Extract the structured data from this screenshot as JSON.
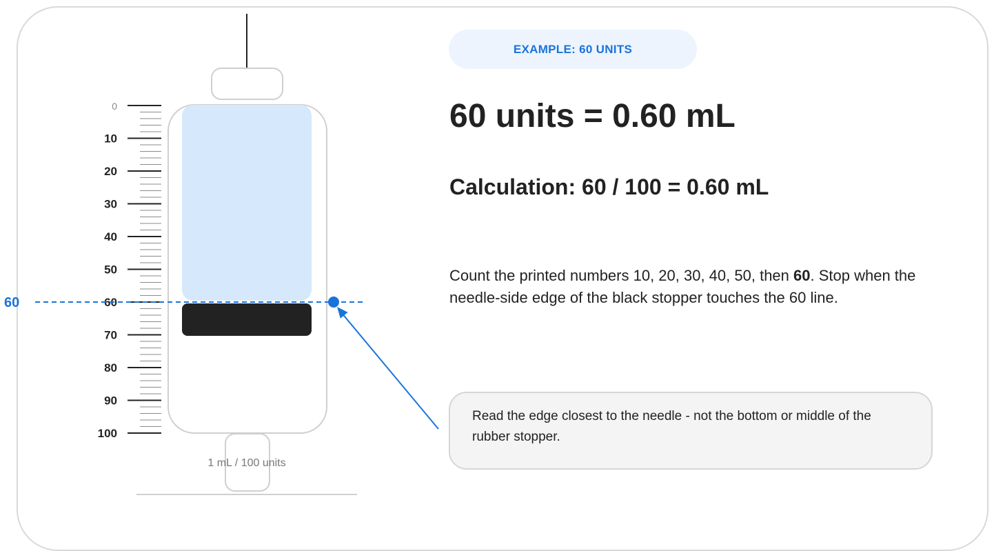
{
  "badge": "EXAMPLE: 60 UNITS",
  "headline": "60 units = 0.60 mL",
  "calculation": "Calculation: 60 / 100 = 0.60 mL",
  "instruction": {
    "part1": "Count the printed numbers 10, 20, 30, 40, 50, then ",
    "emphasis": "60",
    "part2": ". Stop when the needle-side edge of the black stopper touches the 60 line."
  },
  "tip": "Read the edge closest to the needle - not the bottom or middle of the rubber stopper.",
  "syringe": {
    "capacity_label": "1 mL / 100 units",
    "scale_labels": [
      "0",
      "10",
      "20",
      "30",
      "40",
      "50",
      "60",
      "70",
      "80",
      "90",
      "100"
    ],
    "scale_max_units": 100,
    "target_units": 60,
    "target_label": "60"
  },
  "colors": {
    "accent": "#1a73d9",
    "liquid": "#d6e8fb",
    "stopper": "#222222",
    "outline": "#cfcfcf",
    "badge_bg": "#edf4fd",
    "tip_bg": "#f4f4f5"
  }
}
